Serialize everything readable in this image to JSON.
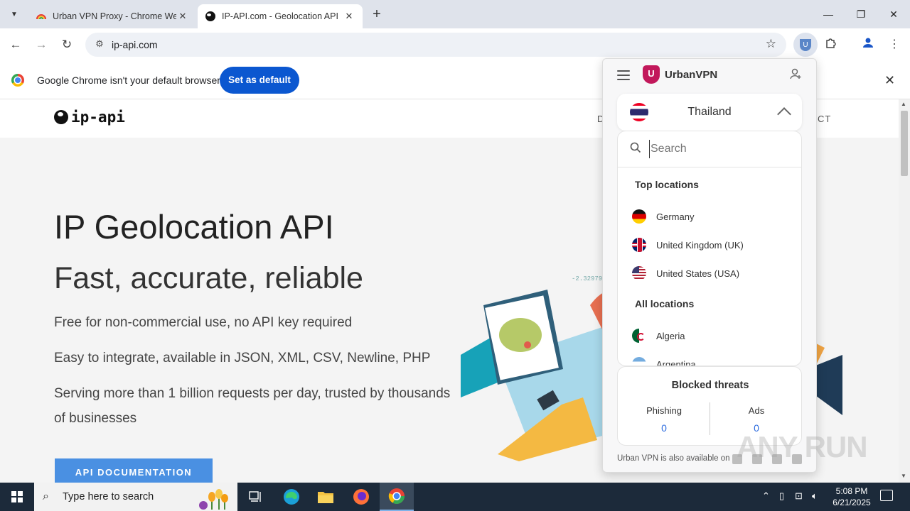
{
  "tabs": [
    {
      "title": "Urban VPN Proxy - Chrome We",
      "close": "✕"
    },
    {
      "title": "IP-API.com - Geolocation API",
      "close": "✕"
    }
  ],
  "newtab": "+",
  "address": {
    "url": "ip-api.com"
  },
  "infobar": {
    "text": "Google Chrome isn't your default browser",
    "button": "Set as default",
    "close": "✕"
  },
  "site": {
    "logo": "ip-api",
    "nav_frag_left": "D",
    "nav_frag_right": "CT",
    "title": "IP Geolocation API",
    "subtitle": "Fast, accurate, reliable",
    "lines": [
      "Free for non-commercial use, no API key required",
      "Easy to integrate, available in JSON, XML, CSV, Newline, PHP",
      "Serving more than 1 billion requests per day, trusted by thousands of businesses"
    ],
    "cta": "API DOCUMENTATION",
    "illus_coord": "-2.32979"
  },
  "vpn": {
    "brand": "UrbanVPN",
    "shield_letter": "U",
    "selected_country": "Thailand",
    "search_placeholder": "Search",
    "top_heading": "Top locations",
    "top_locations": [
      "Germany",
      "United Kingdom (UK)",
      "United States (USA)"
    ],
    "all_heading": "All locations",
    "all_locations": [
      "Algeria",
      "Argentina"
    ],
    "threats": {
      "title": "Blocked threats",
      "phishing_label": "Phishing",
      "phishing_value": "0",
      "ads_label": "Ads",
      "ads_value": "0"
    },
    "footer": "Urban VPN is also available on"
  },
  "taskbar": {
    "search_text": "Type here to search",
    "time": "5:08 PM",
    "date": "6/21/2025"
  },
  "watermark": "ANY RUN",
  "colors": {
    "chrome_blue": "#0b57d0",
    "vpn_accent": "#c2185b",
    "cta": "#4a90e2",
    "taskbar": "#1c2a3a"
  }
}
